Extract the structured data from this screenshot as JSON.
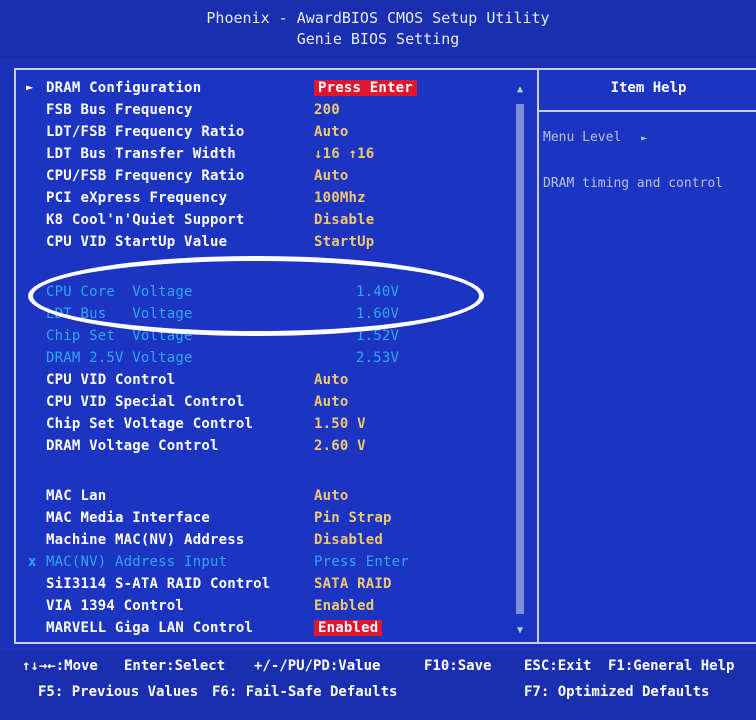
{
  "header": {
    "title": "Phoenix - AwardBIOS CMOS Setup Utility",
    "subtitle": "Genie BIOS Setting"
  },
  "settings": [
    {
      "label": "DRAM Configuration",
      "value": "Press Enter",
      "state": "submenu",
      "highlight": true
    },
    {
      "label": "FSB Bus Frequency",
      "value": "200"
    },
    {
      "label": "LDT/FSB Frequency Ratio",
      "value": "Auto"
    },
    {
      "label": "LDT Bus Transfer Width",
      "value": "↓16 ↑16"
    },
    {
      "label": "CPU/FSB Frequency Ratio",
      "value": "Auto"
    },
    {
      "label": "PCI eXpress Frequency",
      "value": "100Mhz"
    },
    {
      "label": "K8 Cool'n'Quiet Support",
      "value": "Disable"
    },
    {
      "label": "CPU VID StartUp Value",
      "value": "StartUp"
    },
    {
      "label": "CPU Core  Voltage",
      "value": "1.40V",
      "state": "readonly"
    },
    {
      "label": "LDT Bus   Voltage",
      "value": "1.60V",
      "state": "readonly"
    },
    {
      "label": "Chip Set  Voltage",
      "value": "1.52V",
      "state": "readonly"
    },
    {
      "label": "DRAM 2.5V Voltage",
      "value": "2.53V",
      "state": "readonly"
    },
    {
      "label": "CPU VID Control",
      "value": "Auto"
    },
    {
      "label": "CPU VID Special Control",
      "value": "Auto"
    },
    {
      "label": "Chip Set Voltage Control",
      "value": "1.50 V"
    },
    {
      "label": "DRAM Voltage Control",
      "value": "2.60 V"
    },
    {
      "label": "MAC Lan",
      "value": "Auto"
    },
    {
      "label": "MAC Media Interface",
      "value": "Pin Strap"
    },
    {
      "label": "Machine MAC(NV) Address",
      "value": "Disabled"
    },
    {
      "label": "MAC(NV) Address Input",
      "value": "Press Enter",
      "state": "disabled"
    },
    {
      "label": "SiI3114 S-ATA RAID Control",
      "value": "SATA RAID"
    },
    {
      "label": "VIA 1394 Control",
      "value": "Enabled"
    },
    {
      "label": "MARVELL Giga LAN Control",
      "value": "Enabled",
      "highlight": true
    }
  ],
  "help": {
    "title": "Item Help",
    "menu_level": "Menu Level",
    "menu_level_marker": "►",
    "text": "DRAM timing and control"
  },
  "markers": {
    "selected": "►",
    "disabled": "x",
    "scroll_up": "▲",
    "scroll_down": "▼"
  },
  "footer": {
    "move": "↑↓→←:Move",
    "enter": "Enter:Select",
    "value": "+/-/PU/PD:Value",
    "save": "F10:Save",
    "esc": "ESC:Exit",
    "help": "F1:General Help",
    "prev": "F5: Previous Values",
    "failsafe": "F6: Fail-Safe Defaults",
    "optimized": "F7: Optimized Defaults"
  },
  "colors": {
    "background": "#1a31b8",
    "selectable_text": "#ffffff",
    "value_text": "#f0c870",
    "readonly_text": "#2ea8f0",
    "highlight": "#e0162e"
  }
}
